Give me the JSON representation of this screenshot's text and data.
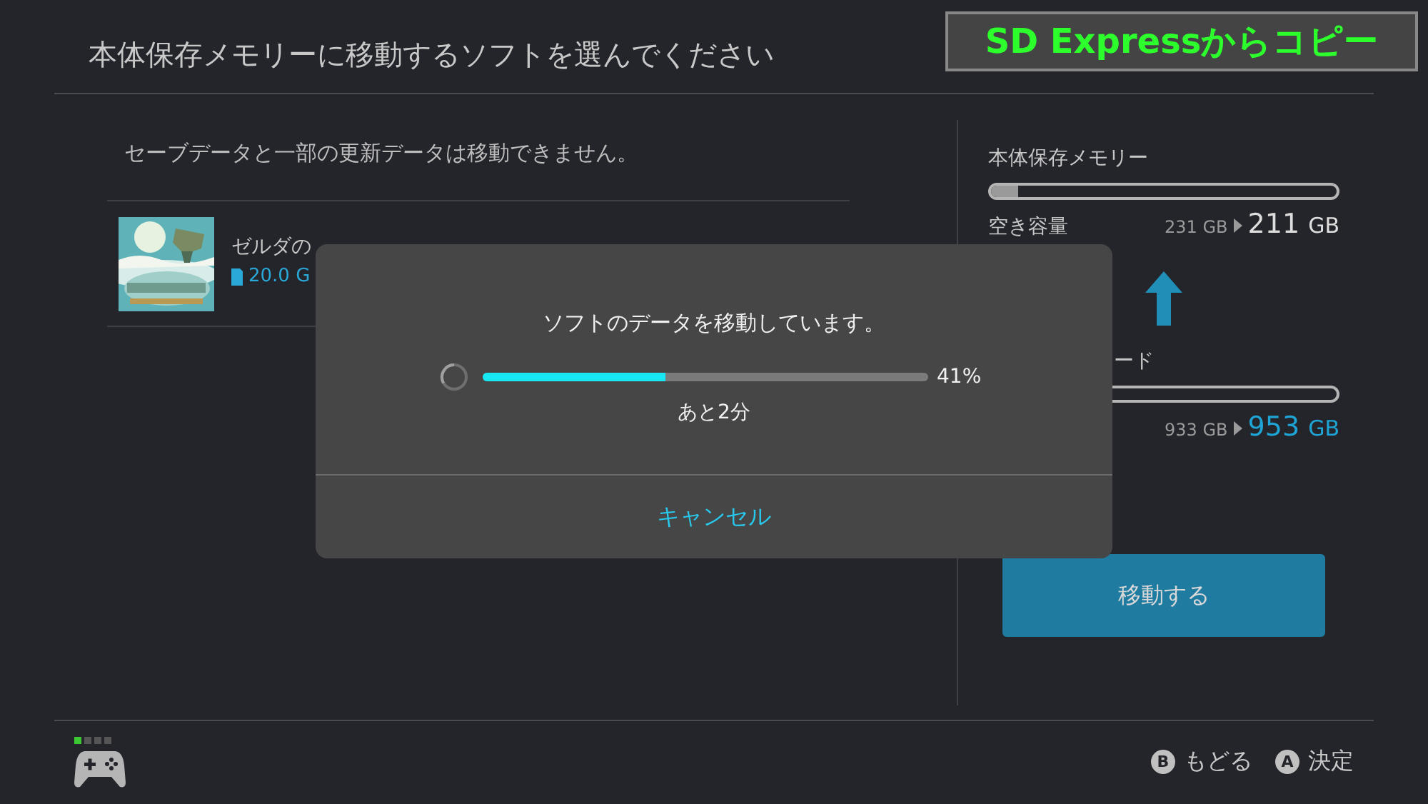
{
  "header": {
    "title": "本体保存メモリーに移動するソフトを選んでください"
  },
  "caption": "SD Expressからコピー",
  "notice": "セーブデータと一部の更新データは移動できません。",
  "software": [
    {
      "kind": "picture",
      "title": "ゼルダの",
      "size": "20.0 G"
    }
  ],
  "storage": [
    {
      "label": "本体保存メモリー",
      "level": 0.08,
      "free_label": "空き容量",
      "before": "231 GB",
      "after_value": "211",
      "after_unit": "GB",
      "highlight": false
    },
    {
      "label": "ード",
      "before": "933 GB",
      "after_value": "953",
      "after_unit": "GB",
      "highlight": true
    }
  ],
  "move_button": "移動する",
  "dialog": {
    "message": "ソフトのデータを移動しています。",
    "level": 0.41,
    "percent": "41%",
    "remaining": "あと2分",
    "cancel": "キャンセル"
  },
  "footer": {
    "player_lamps": [
      {
        "on": true
      },
      {
        "on": false
      },
      {
        "on": false
      },
      {
        "on": false
      }
    ],
    "buttons": [
      {
        "glyph": "B",
        "label": "もどる"
      },
      {
        "glyph": "A",
        "label": "決定"
      }
    ]
  }
}
